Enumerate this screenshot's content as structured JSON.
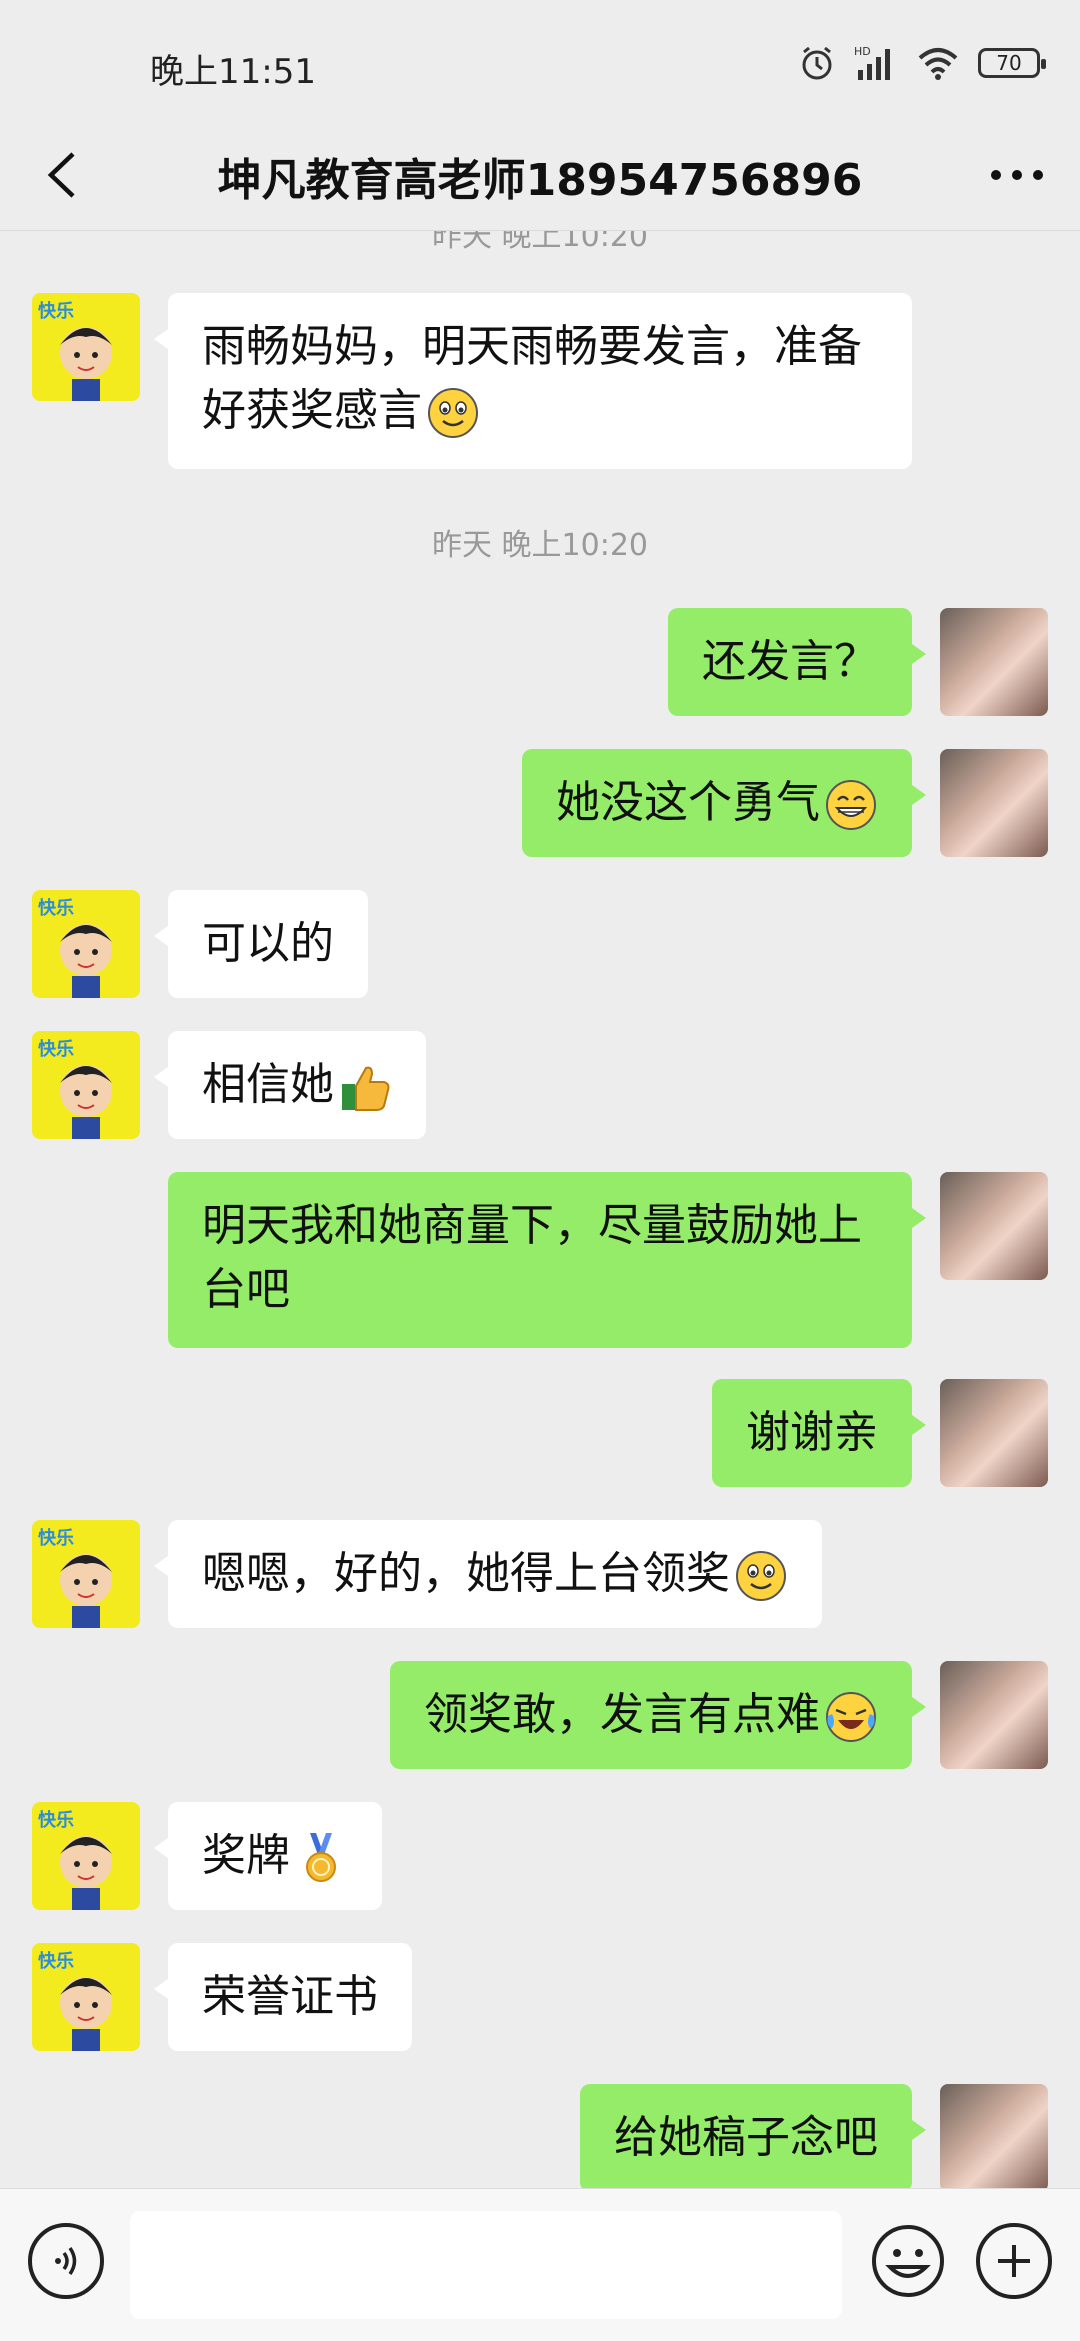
{
  "status": {
    "time": "晚上11:51",
    "battery": "70",
    "network": "HD"
  },
  "header": {
    "title": "坤凡教育高老师18954756896"
  },
  "chat": {
    "partial_timestamp": "昨天 晚上10:20",
    "timestamp": "昨天 晚上10:20",
    "messages": [
      {
        "from": "teacher",
        "text": "雨畅妈妈，明天雨畅要发言，准备好获奖感言",
        "emoji": "smile-emoji"
      },
      {
        "from": "me",
        "text": "还发言？"
      },
      {
        "from": "me",
        "text": "她没这个勇气",
        "emoji": "grin-emoji"
      },
      {
        "from": "teacher",
        "text": "可以的"
      },
      {
        "from": "teacher",
        "text": "相信她",
        "emoji": "thumbs-up-emoji"
      },
      {
        "from": "me",
        "text": "明天我和她商量下，尽量鼓励她上台吧"
      },
      {
        "from": "me",
        "text": "谢谢亲"
      },
      {
        "from": "teacher",
        "text": "嗯嗯，好的，她得上台领奖",
        "emoji": "smile-emoji"
      },
      {
        "from": "me",
        "text": "领奖敢，发言有点难",
        "emoji": "laugh-cry-emoji"
      },
      {
        "from": "teacher",
        "text": "奖牌",
        "emoji": "medal-emoji"
      },
      {
        "from": "teacher",
        "text": "荣誉证书"
      },
      {
        "from": "me",
        "text": "给她稿子念吧"
      }
    ]
  },
  "input": {
    "value": "",
    "placeholder": ""
  },
  "colors": {
    "background": "#EDEDED",
    "outgoing_bubble": "#95EC69",
    "incoming_bubble": "#FFFFFF",
    "teacher_avatar_bg": "#F3EB1D"
  }
}
